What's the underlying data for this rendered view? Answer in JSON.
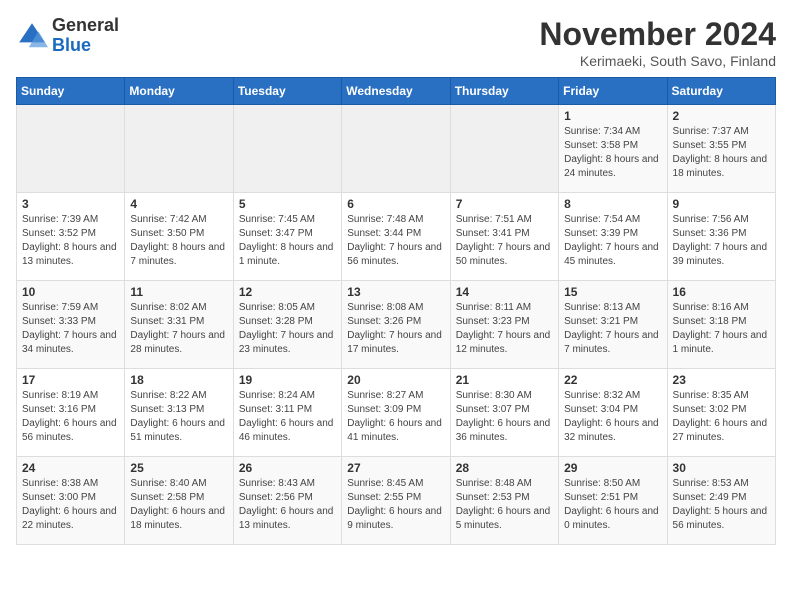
{
  "logo": {
    "general": "General",
    "blue": "Blue"
  },
  "header": {
    "month_title": "November 2024",
    "location": "Kerimaeki, South Savo, Finland"
  },
  "days_of_week": [
    "Sunday",
    "Monday",
    "Tuesday",
    "Wednesday",
    "Thursday",
    "Friday",
    "Saturday"
  ],
  "weeks": [
    [
      {
        "day": "",
        "info": ""
      },
      {
        "day": "",
        "info": ""
      },
      {
        "day": "",
        "info": ""
      },
      {
        "day": "",
        "info": ""
      },
      {
        "day": "",
        "info": ""
      },
      {
        "day": "1",
        "info": "Sunrise: 7:34 AM\nSunset: 3:58 PM\nDaylight: 8 hours and 24 minutes."
      },
      {
        "day": "2",
        "info": "Sunrise: 7:37 AM\nSunset: 3:55 PM\nDaylight: 8 hours and 18 minutes."
      }
    ],
    [
      {
        "day": "3",
        "info": "Sunrise: 7:39 AM\nSunset: 3:52 PM\nDaylight: 8 hours and 13 minutes."
      },
      {
        "day": "4",
        "info": "Sunrise: 7:42 AM\nSunset: 3:50 PM\nDaylight: 8 hours and 7 minutes."
      },
      {
        "day": "5",
        "info": "Sunrise: 7:45 AM\nSunset: 3:47 PM\nDaylight: 8 hours and 1 minute."
      },
      {
        "day": "6",
        "info": "Sunrise: 7:48 AM\nSunset: 3:44 PM\nDaylight: 7 hours and 56 minutes."
      },
      {
        "day": "7",
        "info": "Sunrise: 7:51 AM\nSunset: 3:41 PM\nDaylight: 7 hours and 50 minutes."
      },
      {
        "day": "8",
        "info": "Sunrise: 7:54 AM\nSunset: 3:39 PM\nDaylight: 7 hours and 45 minutes."
      },
      {
        "day": "9",
        "info": "Sunrise: 7:56 AM\nSunset: 3:36 PM\nDaylight: 7 hours and 39 minutes."
      }
    ],
    [
      {
        "day": "10",
        "info": "Sunrise: 7:59 AM\nSunset: 3:33 PM\nDaylight: 7 hours and 34 minutes."
      },
      {
        "day": "11",
        "info": "Sunrise: 8:02 AM\nSunset: 3:31 PM\nDaylight: 7 hours and 28 minutes."
      },
      {
        "day": "12",
        "info": "Sunrise: 8:05 AM\nSunset: 3:28 PM\nDaylight: 7 hours and 23 minutes."
      },
      {
        "day": "13",
        "info": "Sunrise: 8:08 AM\nSunset: 3:26 PM\nDaylight: 7 hours and 17 minutes."
      },
      {
        "day": "14",
        "info": "Sunrise: 8:11 AM\nSunset: 3:23 PM\nDaylight: 7 hours and 12 minutes."
      },
      {
        "day": "15",
        "info": "Sunrise: 8:13 AM\nSunset: 3:21 PM\nDaylight: 7 hours and 7 minutes."
      },
      {
        "day": "16",
        "info": "Sunrise: 8:16 AM\nSunset: 3:18 PM\nDaylight: 7 hours and 1 minute."
      }
    ],
    [
      {
        "day": "17",
        "info": "Sunrise: 8:19 AM\nSunset: 3:16 PM\nDaylight: 6 hours and 56 minutes."
      },
      {
        "day": "18",
        "info": "Sunrise: 8:22 AM\nSunset: 3:13 PM\nDaylight: 6 hours and 51 minutes."
      },
      {
        "day": "19",
        "info": "Sunrise: 8:24 AM\nSunset: 3:11 PM\nDaylight: 6 hours and 46 minutes."
      },
      {
        "day": "20",
        "info": "Sunrise: 8:27 AM\nSunset: 3:09 PM\nDaylight: 6 hours and 41 minutes."
      },
      {
        "day": "21",
        "info": "Sunrise: 8:30 AM\nSunset: 3:07 PM\nDaylight: 6 hours and 36 minutes."
      },
      {
        "day": "22",
        "info": "Sunrise: 8:32 AM\nSunset: 3:04 PM\nDaylight: 6 hours and 32 minutes."
      },
      {
        "day": "23",
        "info": "Sunrise: 8:35 AM\nSunset: 3:02 PM\nDaylight: 6 hours and 27 minutes."
      }
    ],
    [
      {
        "day": "24",
        "info": "Sunrise: 8:38 AM\nSunset: 3:00 PM\nDaylight: 6 hours and 22 minutes."
      },
      {
        "day": "25",
        "info": "Sunrise: 8:40 AM\nSunset: 2:58 PM\nDaylight: 6 hours and 18 minutes."
      },
      {
        "day": "26",
        "info": "Sunrise: 8:43 AM\nSunset: 2:56 PM\nDaylight: 6 hours and 13 minutes."
      },
      {
        "day": "27",
        "info": "Sunrise: 8:45 AM\nSunset: 2:55 PM\nDaylight: 6 hours and 9 minutes."
      },
      {
        "day": "28",
        "info": "Sunrise: 8:48 AM\nSunset: 2:53 PM\nDaylight: 6 hours and 5 minutes."
      },
      {
        "day": "29",
        "info": "Sunrise: 8:50 AM\nSunset: 2:51 PM\nDaylight: 6 hours and 0 minutes."
      },
      {
        "day": "30",
        "info": "Sunrise: 8:53 AM\nSunset: 2:49 PM\nDaylight: 5 hours and 56 minutes."
      }
    ]
  ]
}
